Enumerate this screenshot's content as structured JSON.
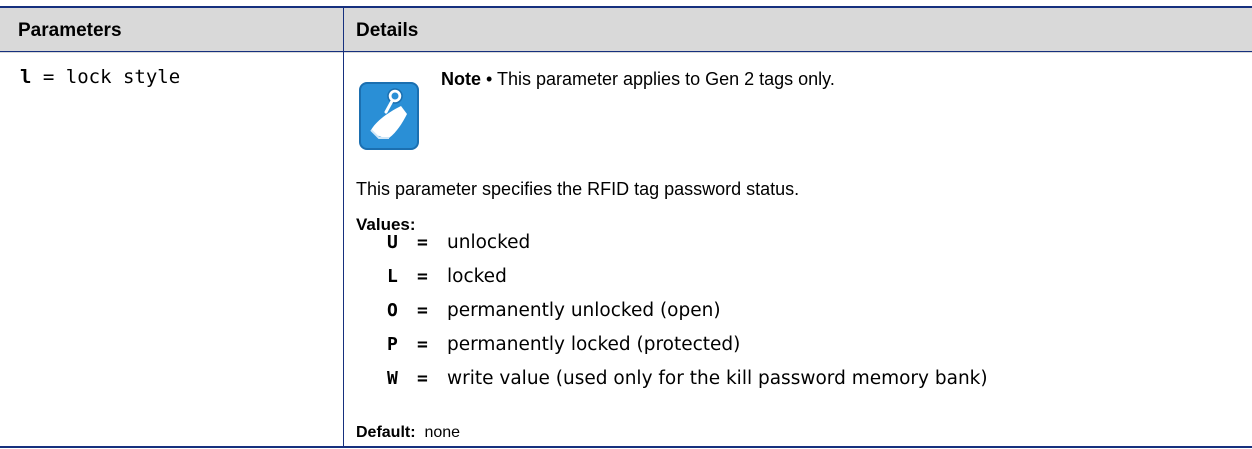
{
  "table": {
    "header": {
      "parameters": "Parameters",
      "details": "Details"
    },
    "row": {
      "parameter_code": "l",
      "parameter_rest": " = lock style",
      "note_label": "Note",
      "note_bullet": " • ",
      "note_text": "This parameter applies to Gen 2 tags only.",
      "description": "This parameter specifies the RFID tag password status.",
      "values_label": "Values:",
      "values": [
        {
          "code": "U",
          "eq": "=",
          "desc": "unlocked"
        },
        {
          "code": "L",
          "eq": "=",
          "desc": "locked"
        },
        {
          "code": "O",
          "eq": "=",
          "desc": "permanently unlocked (open)"
        },
        {
          "code": "P",
          "eq": "=",
          "desc": "permanently locked (protected)"
        },
        {
          "code": "W",
          "eq": "=",
          "desc": "write value (used only for the kill password memory bank)"
        }
      ],
      "default_label": "Default:",
      "default_value": "none"
    }
  },
  "icons": {
    "note": "note-pushpin-icon"
  },
  "colors": {
    "rule": "#16307e",
    "header_bg": "#d9d9d9",
    "icon_blue": "#2a8fd6"
  }
}
